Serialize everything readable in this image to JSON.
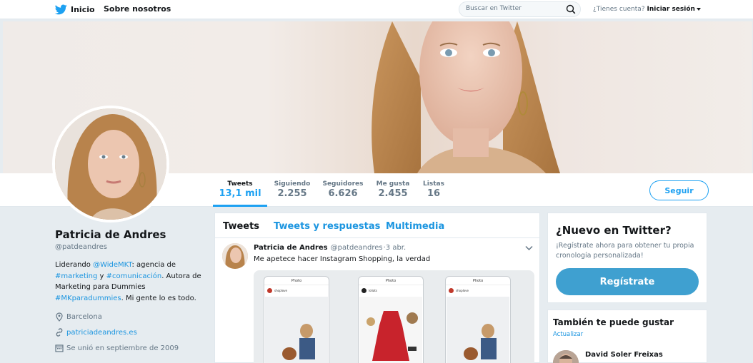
{
  "nav": {
    "home_label": "Inicio",
    "about_label": "Sobre nosotros",
    "search_placeholder": "Buscar en Twitter",
    "account_question": "¿Tienes cuenta?",
    "login_label": "Iniciar sesión"
  },
  "stats": [
    {
      "label": "Tweets",
      "value": "13,1 mil"
    },
    {
      "label": "Siguiendo",
      "value": "2.255"
    },
    {
      "label": "Seguidores",
      "value": "6.626"
    },
    {
      "label": "Me gusta",
      "value": "2.455"
    },
    {
      "label": "Listas",
      "value": "16"
    }
  ],
  "follow_label": "Seguir",
  "profile": {
    "name": "Patricia de Andres",
    "handle": "@patdeandres",
    "bio": {
      "t1": "Liderando ",
      "mention": "@WideMKT",
      "t2": ": agencia de ",
      "tag1": "#marketing",
      "t3": " y ",
      "tag2": "#comunicación",
      "t4": ". Autora de Marketing para Dummies ",
      "tag3": "#MKparadummies",
      "t5": ". Mi gente lo es todo."
    },
    "location": "Barcelona",
    "website": "patriciadeandres.es",
    "joined": "Se unió en septiembre de 2009"
  },
  "timeline": {
    "tabs": [
      "Tweets",
      "Tweets y respuestas",
      "Multimedia"
    ],
    "tweet": {
      "author": "Patricia de Andres",
      "handle": "@patdeandres",
      "time": "·3 abr.",
      "text": "Me apetece hacer Instagram Shopping, la verdad"
    }
  },
  "signup": {
    "title": "¿Nuevo en Twitter?",
    "description": "¡Regístrate ahora para obtener tu propia cronología personalizada!",
    "button": "Regístrate"
  },
  "who_to_follow": {
    "title": "También te puede gustar",
    "refresh": "Actualizar",
    "user": "David Soler Freixas"
  },
  "colors": {
    "accent": "#1da1f2",
    "link": "#1b95e0",
    "signup_button": "#3fa0d0"
  }
}
